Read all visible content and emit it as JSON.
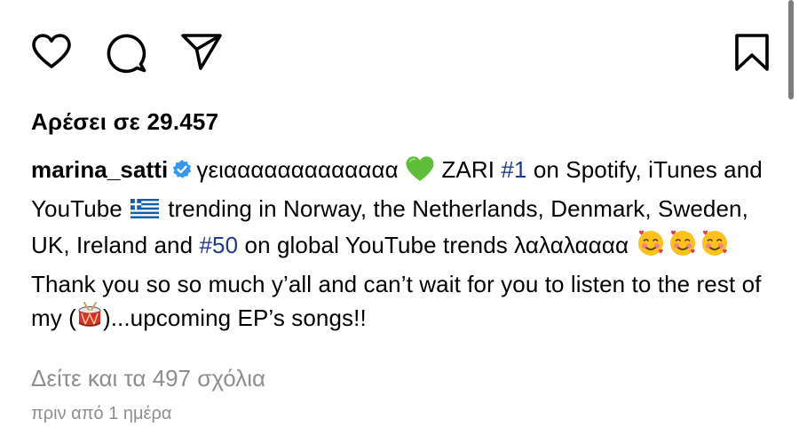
{
  "actions": {
    "like_icon": "heart-outline-icon",
    "comment_icon": "speech-bubble-icon",
    "share_icon": "paper-plane-icon",
    "save_icon": "bookmark-outline-icon"
  },
  "likes_text": "Αρέσει σε 29.457",
  "caption": {
    "username": "marina_satti",
    "verified_icon": "verified-badge-icon",
    "seg1": "γειααααααααααααα",
    "seg2": " ZARI ",
    "hashtag1": "#1",
    "seg3": " on Spotify, iTunes and YouTube ",
    "seg4": "trending in Norway, the Netherlands, Denmark, Sweden, UK, Ireland and ",
    "hashtag2": "#50",
    "seg5": " on global YouTube trends λαλαλαααα ",
    "line2a": "Thank you so so much y’all and can’t wait for you to listen to the rest of my (",
    "line2b": ")...upcoming EP’s songs!!"
  },
  "comments_link": "Δείτε και τα 497 σχόλια",
  "timestamp": "πριν από 1 ημέρα",
  "colors": {
    "hashtag": "#1f3a8f",
    "muted": "#8e8e8e",
    "verified": "#3897f0"
  }
}
